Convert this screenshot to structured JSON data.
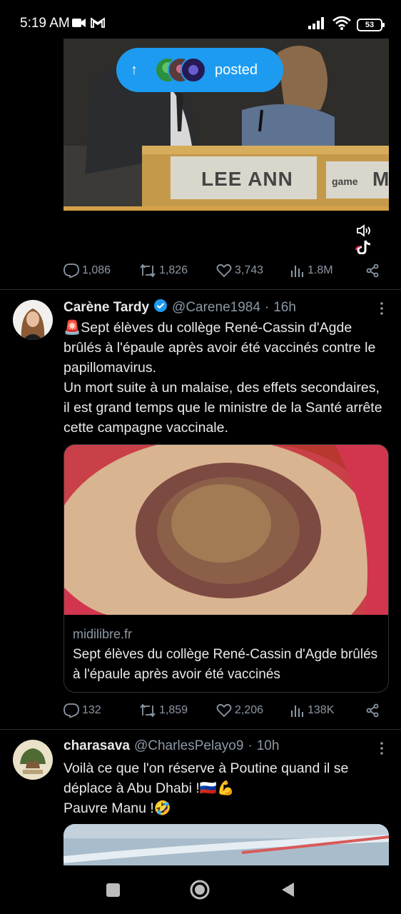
{
  "status": {
    "time": "5:19 AM",
    "battery": "53"
  },
  "prev_tweet": {
    "posted_label": "posted",
    "video_nameplate": "LEE ANN",
    "video_nameplate2": "game",
    "video_nameplate3": "M",
    "replies": "1,086",
    "retweets": "1,826",
    "likes": "3,743",
    "views": "1.8M"
  },
  "tweet1": {
    "name": "Carène Tardy",
    "handle": "@Carene1984",
    "dot": "·",
    "time": "16h",
    "emoji": "🚨",
    "line1": "Sept élèves du collège René-Cassin d'Agde brûlés à l'épaule après avoir été vaccinés contre le papillomavirus.",
    "line2": "Un mort suite à un malaise, des effets secondaires, il est grand temps que le ministre de la Santé arrête cette campagne vaccinale.",
    "card_domain": "midilibre.fr",
    "card_title": "Sept élèves du collège René-Cassin d'Agde brûlés à l'épaule après avoir été vaccinés",
    "replies": "132",
    "retweets": "1,859",
    "likes": "2,206",
    "views": "138K",
    "verified_color": "#1d9bf0"
  },
  "tweet2": {
    "name": "charasava",
    "handle": "@CharlesPelayo9",
    "dot": "·",
    "time": "10h",
    "line1": "Voilà ce que l'on réserve à Poutine quand il se déplace à Abu Dhabi !🇷🇺💪",
    "line2": "Pauvre Manu !🤣"
  },
  "colors": {
    "accent": "#1d9bf0",
    "muted": "#8b98a5",
    "text": "#e7e9ea",
    "bg": "#000000"
  }
}
